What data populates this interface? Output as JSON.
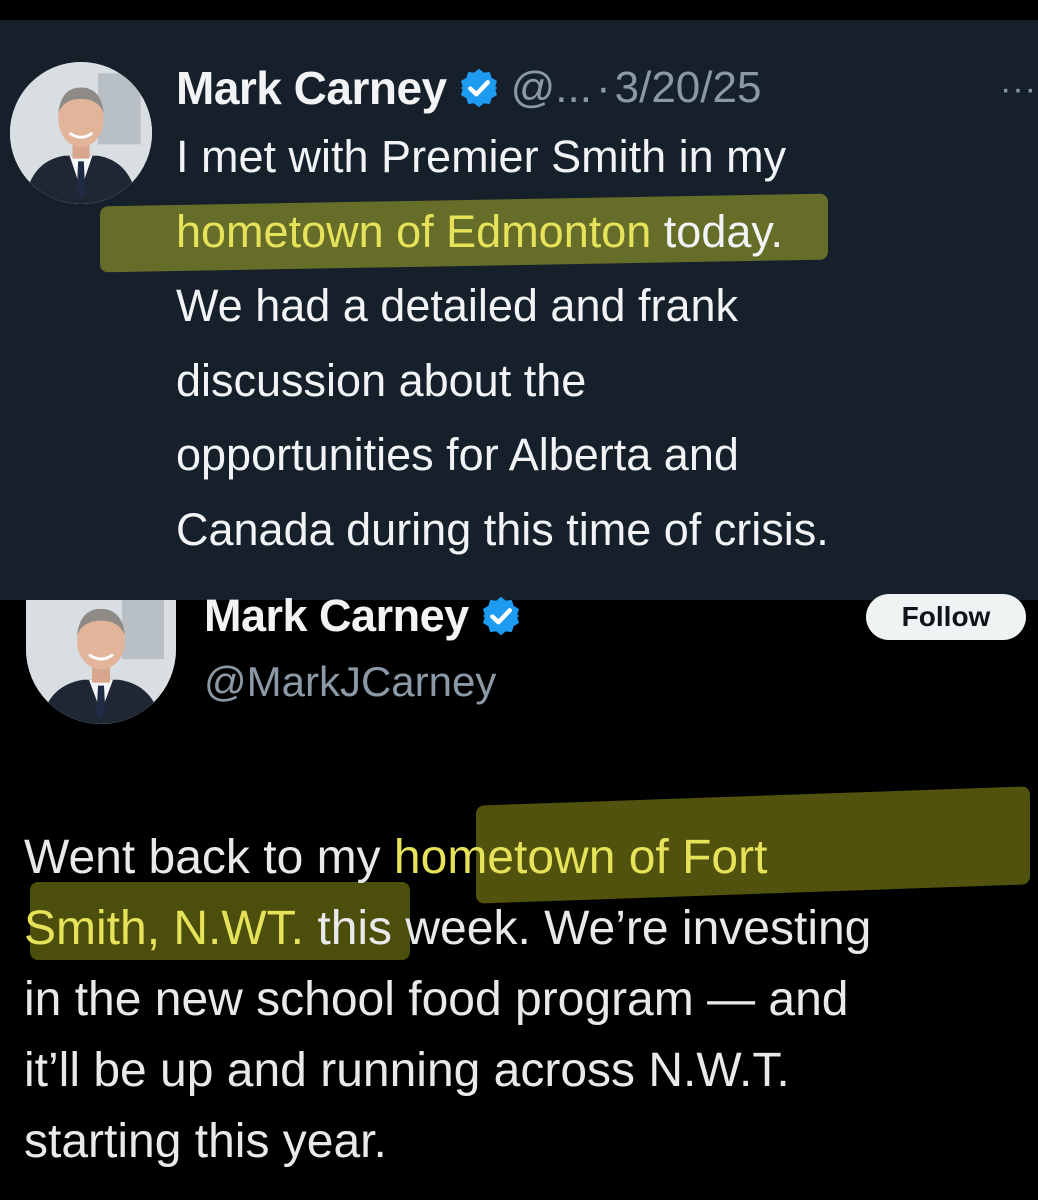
{
  "top_tweet": {
    "author_name": "Mark Carney",
    "handle_truncated": "@...",
    "separator": "·",
    "date": "3/20/25",
    "more_label": "···",
    "lines": [
      {
        "pre": "I met with Premier Smith in my",
        "hl": "",
        "post": ""
      },
      {
        "pre": "",
        "hl": "hometown of Edmonton",
        "post": " today."
      },
      {
        "pre": "We had a detailed and frank",
        "hl": "",
        "post": ""
      },
      {
        "pre": "discussion about the",
        "hl": "",
        "post": ""
      },
      {
        "pre": "opportunities for Alberta and",
        "hl": "",
        "post": ""
      },
      {
        "pre": "Canada during this time of crisis.",
        "hl": "",
        "post": ""
      }
    ]
  },
  "bottom_tweet": {
    "author_name": "Mark Carney",
    "handle": "@MarkJCarney",
    "follow_label": "Follow",
    "lines": [
      {
        "pre": "Went back to my ",
        "hl": "hometown of Fort",
        "post": ""
      },
      {
        "pre": "",
        "hl": "Smith, N.WT.",
        "post": " this week. We’re investing"
      },
      {
        "pre": "in the new school food program — and",
        "hl": "",
        "post": ""
      },
      {
        "pre": "it’ll be up and running across N.W.T.",
        "hl": "",
        "post": ""
      },
      {
        "pre": "starting this year.",
        "hl": "",
        "post": ""
      }
    ]
  },
  "colors": {
    "top_background": "#15202b",
    "bottom_background": "#000000",
    "highlight_text": "#e6e25a",
    "verified_badge": "#1d9bf0",
    "muted_text": "#8b98a5"
  }
}
